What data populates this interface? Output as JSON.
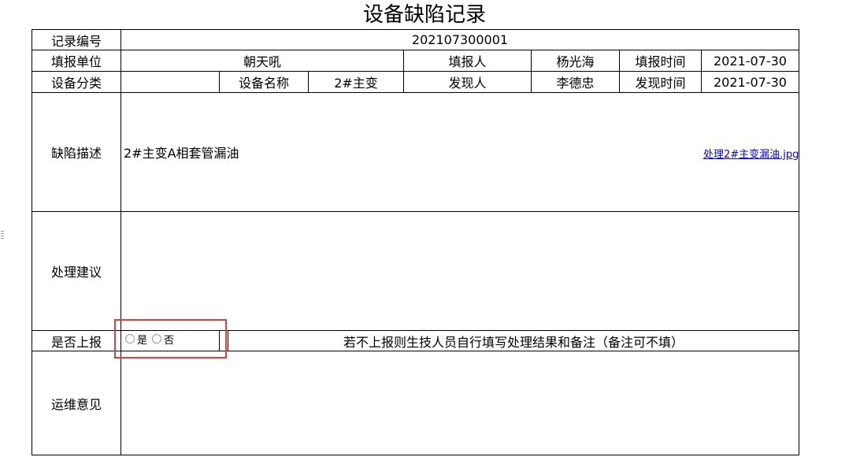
{
  "title": "设备缺陷记录",
  "labels": {
    "record_no": "记录编号",
    "report_unit": "填报单位",
    "reporter": "填报人",
    "report_time": "填报时间",
    "category": "设备分类",
    "device_name": "设备名称",
    "finder": "发现人",
    "find_time": "发现时间",
    "defect_desc": "缺陷描述",
    "suggestion": "处理建议",
    "escalate": "是否上报",
    "ops_opinion": "运维意见"
  },
  "values": {
    "record_no": "202107300001",
    "report_unit": "朝天吼",
    "reporter": "杨光海",
    "report_time": "2021-07-30",
    "category": "",
    "device_name": "2#主变",
    "finder": "李德忠",
    "find_time": "2021-07-30",
    "defect_desc": "2#主变A相套管漏油",
    "attachment": "处理2#主变漏油.jpg",
    "suggestion": "",
    "ops_opinion": ""
  },
  "escalate": {
    "options": [
      "是",
      "否"
    ],
    "selected": null,
    "note": "若不上报则生技人员自行填写处理结果和备注（备注可不填）"
  }
}
